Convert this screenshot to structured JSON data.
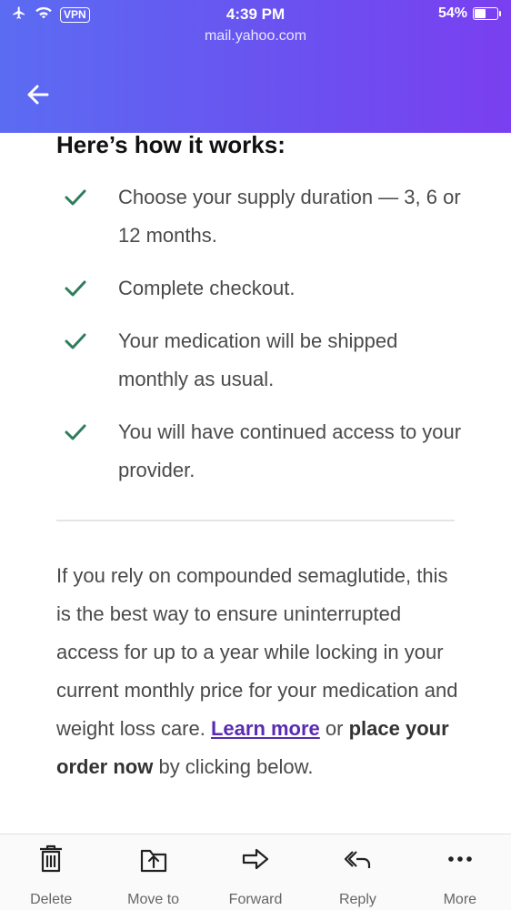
{
  "status_bar": {
    "vpn_label": "VPN",
    "time": "4:39 PM",
    "battery_percent": "54%",
    "battery_level": 0.54,
    "icons": [
      "airplane-icon",
      "wifi-icon"
    ]
  },
  "browser": {
    "url": "mail.yahoo.com"
  },
  "email": {
    "heading": "Here’s how it works:",
    "steps": [
      {
        "text": "Choose your supply duration — 3, 6 or 12 months."
      },
      {
        "text": "Complete checkout."
      },
      {
        "text": "Your medication will be shipped monthly as usual."
      },
      {
        "text": "You will have continued access to your provider."
      }
    ],
    "paragraph": {
      "text_before_link": "If you rely on compounded semaglutide, this is the best way to ensure uninterrupted access for up to a year while locking in your current monthly price for your medication and weight loss care. ",
      "link_text": "Learn more",
      "text_mid": " or ",
      "bold_text": "place your order now",
      "text_after": " by clicking below."
    }
  },
  "toolbar": {
    "delete_label": "Delete",
    "move_label": "Move to",
    "forward_label": "Forward",
    "reply_label": "Reply",
    "more_label": "More"
  },
  "colors": {
    "header_gradient_start": "#5b6cf2",
    "header_gradient_end": "#7a3ff0",
    "check_green": "#2e7d5b",
    "link_purple": "#5a2bb0"
  }
}
